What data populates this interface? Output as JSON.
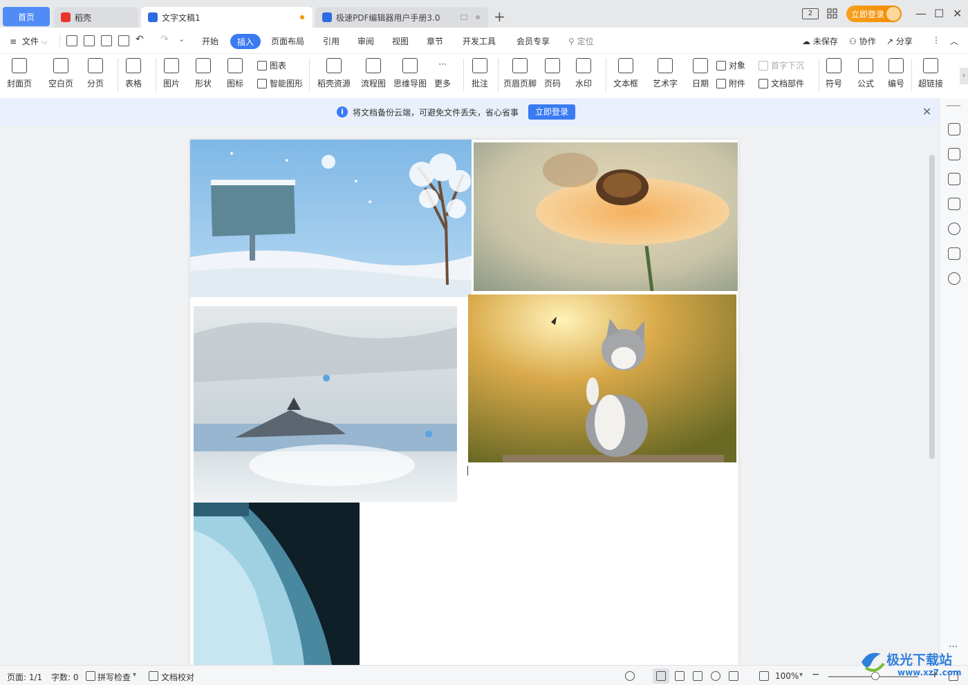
{
  "titlebar": {
    "tabs": [
      {
        "label": "首页"
      },
      {
        "label": "稻壳"
      },
      {
        "label": "文字文稿1"
      },
      {
        "label": "极速PDF编辑器用户手册3.0"
      }
    ],
    "new_tab": "+",
    "login_label": "立即登录",
    "window_buttons": [
      "—",
      "☐",
      "✕"
    ],
    "page_counter": "2"
  },
  "menu": {
    "file": "文件",
    "items": [
      "开始",
      "插入",
      "页面布局",
      "引用",
      "审阅",
      "视图",
      "章节",
      "开发工具",
      "会员专享"
    ],
    "active": "插入",
    "search": "定位",
    "unsaved": "未保存",
    "collab": "协作",
    "share": "分享"
  },
  "ribbon": {
    "cover": "封面页",
    "blank": "空白页",
    "pagebreak": "分页",
    "table": "表格",
    "picture": "图片",
    "shape": "形状",
    "iconlib": "图标",
    "chart": "图表",
    "smartart": "智能图形",
    "daoke_res": "稻壳资源",
    "flowchart": "流程图",
    "mindmap": "思维导图",
    "more": "更多",
    "comment": "批注",
    "headerfooter": "页眉页脚",
    "pagenum": "页码",
    "watermark": "水印",
    "textbox": "文本框",
    "wordart": "艺术字",
    "date": "日期",
    "object": "对象",
    "attachment": "附件",
    "dropcap": "首字下沉",
    "docpart": "文档部件",
    "symbol": "符号",
    "formula": "公式",
    "numbering": "编号",
    "hyperlink": "超链接"
  },
  "notice": {
    "text": "将文档备份云端，可避免文件丢失，省心省事",
    "button": "立即登录"
  },
  "status": {
    "page": "页面: 1/1",
    "words": "字数: 0",
    "spell": "拼写检查",
    "proof": "文档校对",
    "zoom": "100%"
  },
  "watermark": {
    "title": "极光下载站",
    "url": "www.xz7.com"
  },
  "colors": {
    "accent": "#3a7af2",
    "login_orange": "#f39800",
    "home_tab": "#4f8cf6"
  }
}
